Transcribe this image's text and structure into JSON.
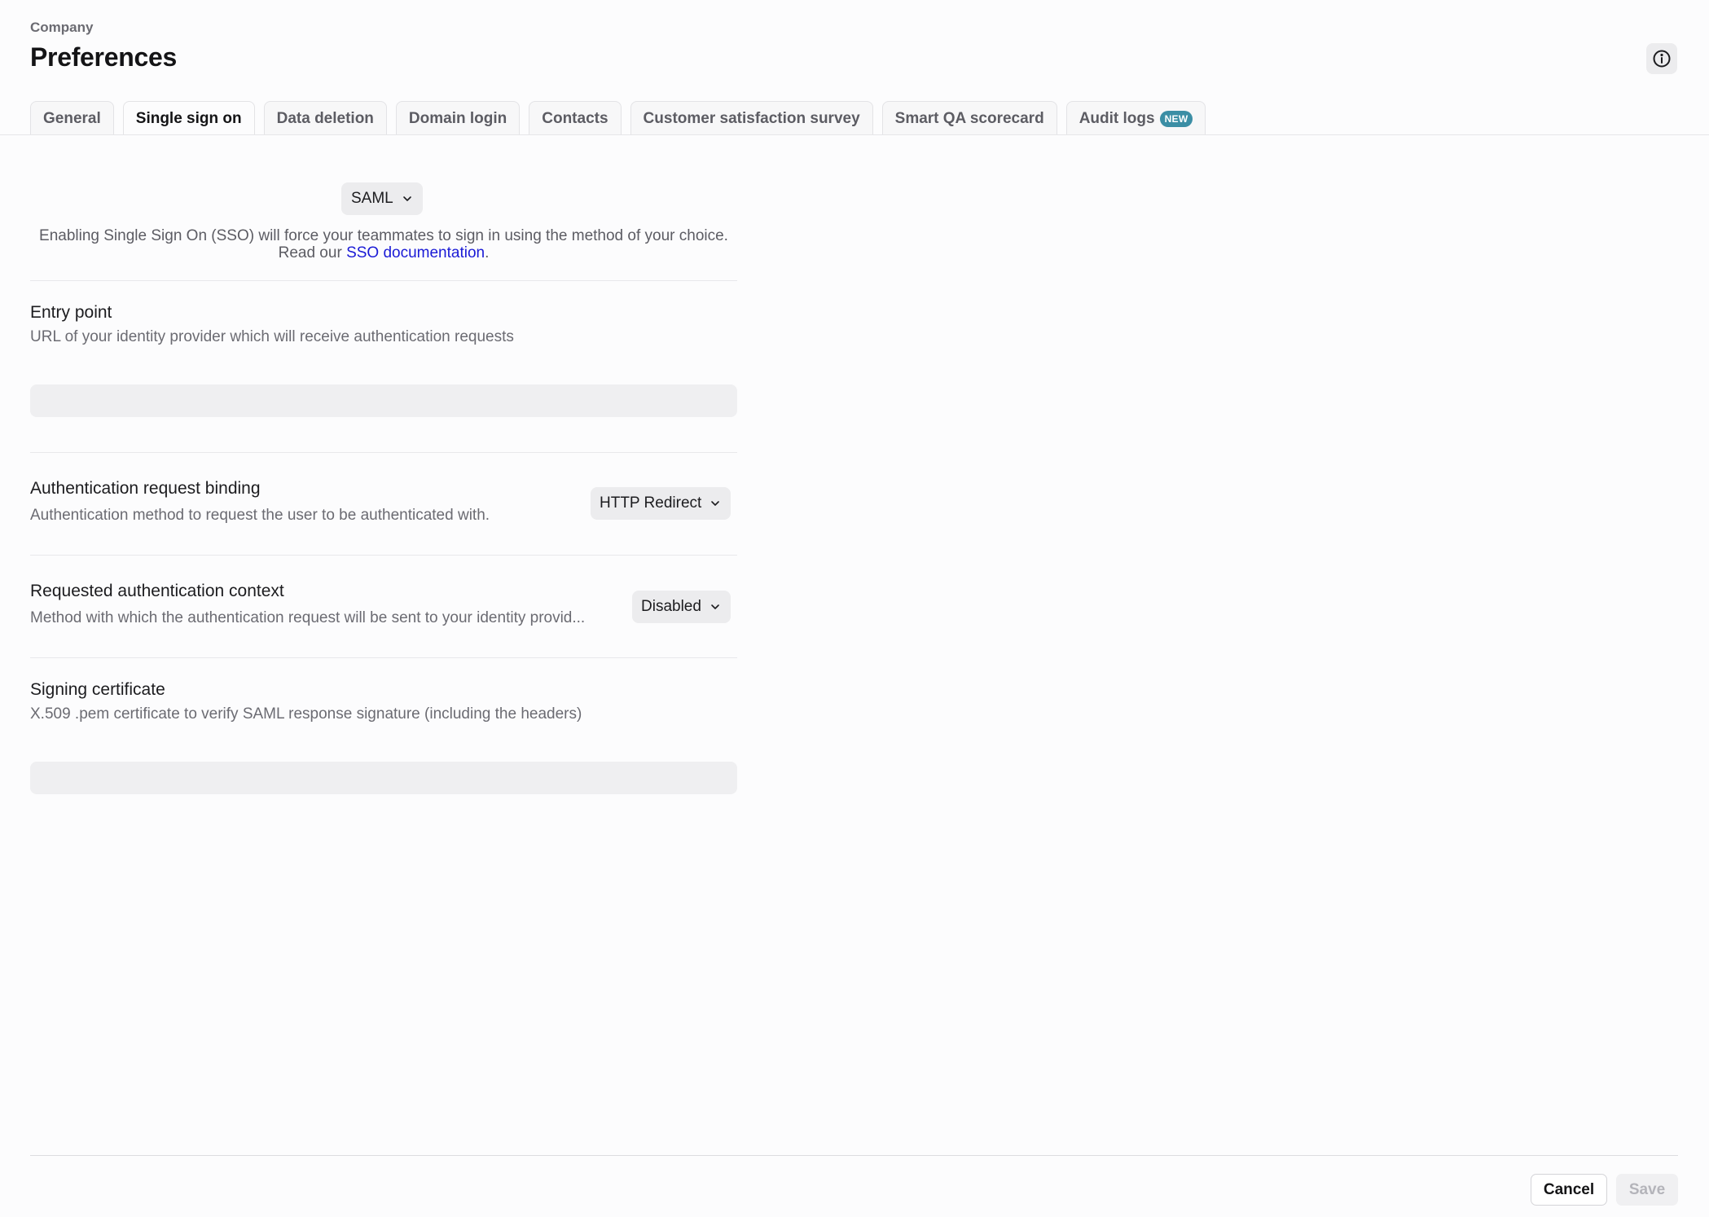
{
  "header": {
    "eyebrow": "Company",
    "title": "Preferences",
    "info_icon": "info-circle-icon"
  },
  "tabs": [
    {
      "label": "General",
      "active": false
    },
    {
      "label": "Single sign on",
      "active": true
    },
    {
      "label": "Data deletion",
      "active": false
    },
    {
      "label": "Domain login",
      "active": false
    },
    {
      "label": "Contacts",
      "active": false
    },
    {
      "label": "Customer satisfaction survey",
      "active": false
    },
    {
      "label": "Smart QA scorecard",
      "active": false
    },
    {
      "label": "Audit logs",
      "active": false,
      "badge": "NEW"
    }
  ],
  "sso": {
    "method": "SAML",
    "intro_text": "Enabling Single Sign On (SSO) will force your teammates to sign in using the method of your choice.",
    "doc_prefix": "Read our",
    "doc_link": "SSO documentation",
    "doc_suffix": "."
  },
  "fields": {
    "entry_point": {
      "title": "Entry point",
      "description": "URL of your identity provider which will receive authentication requests",
      "value": ""
    },
    "auth_binding": {
      "title": "Authentication request binding",
      "description": "Authentication method to request the user to be authenticated with.",
      "value": "HTTP Redirect"
    },
    "auth_context": {
      "title": "Requested authentication context",
      "description": "Method with which the authentication request will be sent to your identity provid...",
      "value": "Disabled"
    },
    "signing_cert": {
      "title": "Signing certificate",
      "description": "X.509 .pem certificate to verify SAML response signature (including the headers)",
      "value": ""
    }
  },
  "footer": {
    "cancel_label": "Cancel",
    "save_label": "Save"
  },
  "colors": {
    "badge": "#3b8ea5",
    "link": "#1a1ad6",
    "background": "#fcfcfd"
  }
}
